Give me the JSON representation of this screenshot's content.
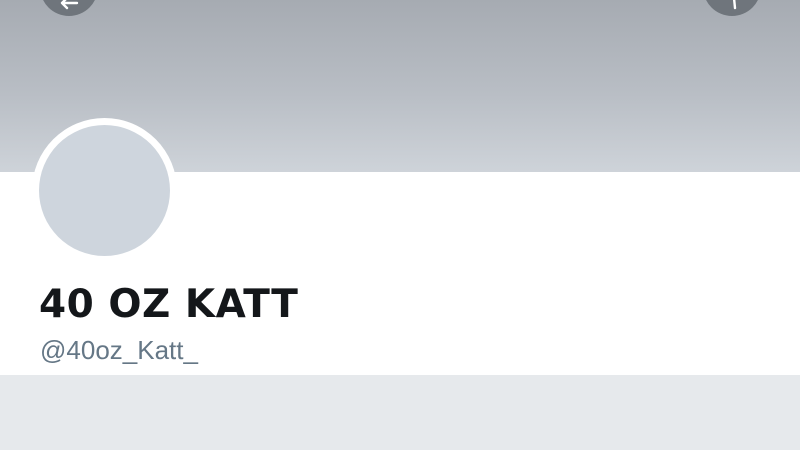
{
  "profile": {
    "display_name": "40 OZ KATT",
    "handle": "@40oz_Katt_"
  },
  "header": {
    "back_icon": "arrow-left-icon",
    "more_icon": "more-icon"
  },
  "colors": {
    "banner_top": "#a6abb2",
    "banner_bottom": "#ced3d9",
    "avatar_placeholder": "#ced5dd",
    "name_text": "#14171a",
    "handle_text": "#657786",
    "page_background": "#e6e9ec"
  }
}
